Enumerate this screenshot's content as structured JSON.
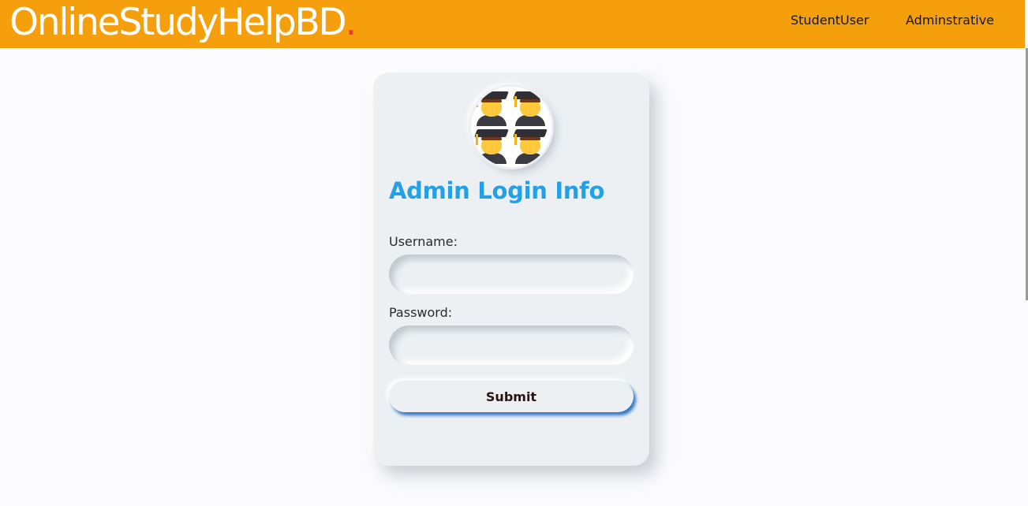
{
  "navbar": {
    "brand": "OnlineStudyHelpBD",
    "brand_dot": ".",
    "links": [
      "StudentUser",
      "Adminstrative"
    ]
  },
  "login": {
    "title": "Admin Login Info",
    "username_label": "Username:",
    "username_value": "",
    "password_label": "Password:",
    "password_value": "",
    "submit_label": "Submit",
    "avatar_icon": "graduate-students-icon"
  },
  "colors": {
    "navbar_bg": "#f59f0d",
    "brand_text": "#ffffff",
    "brand_dot": "#ee3b36",
    "title": "#24a0e6",
    "card_bg": "#ecf0f3",
    "submit_shadow": "#2f74c5"
  }
}
